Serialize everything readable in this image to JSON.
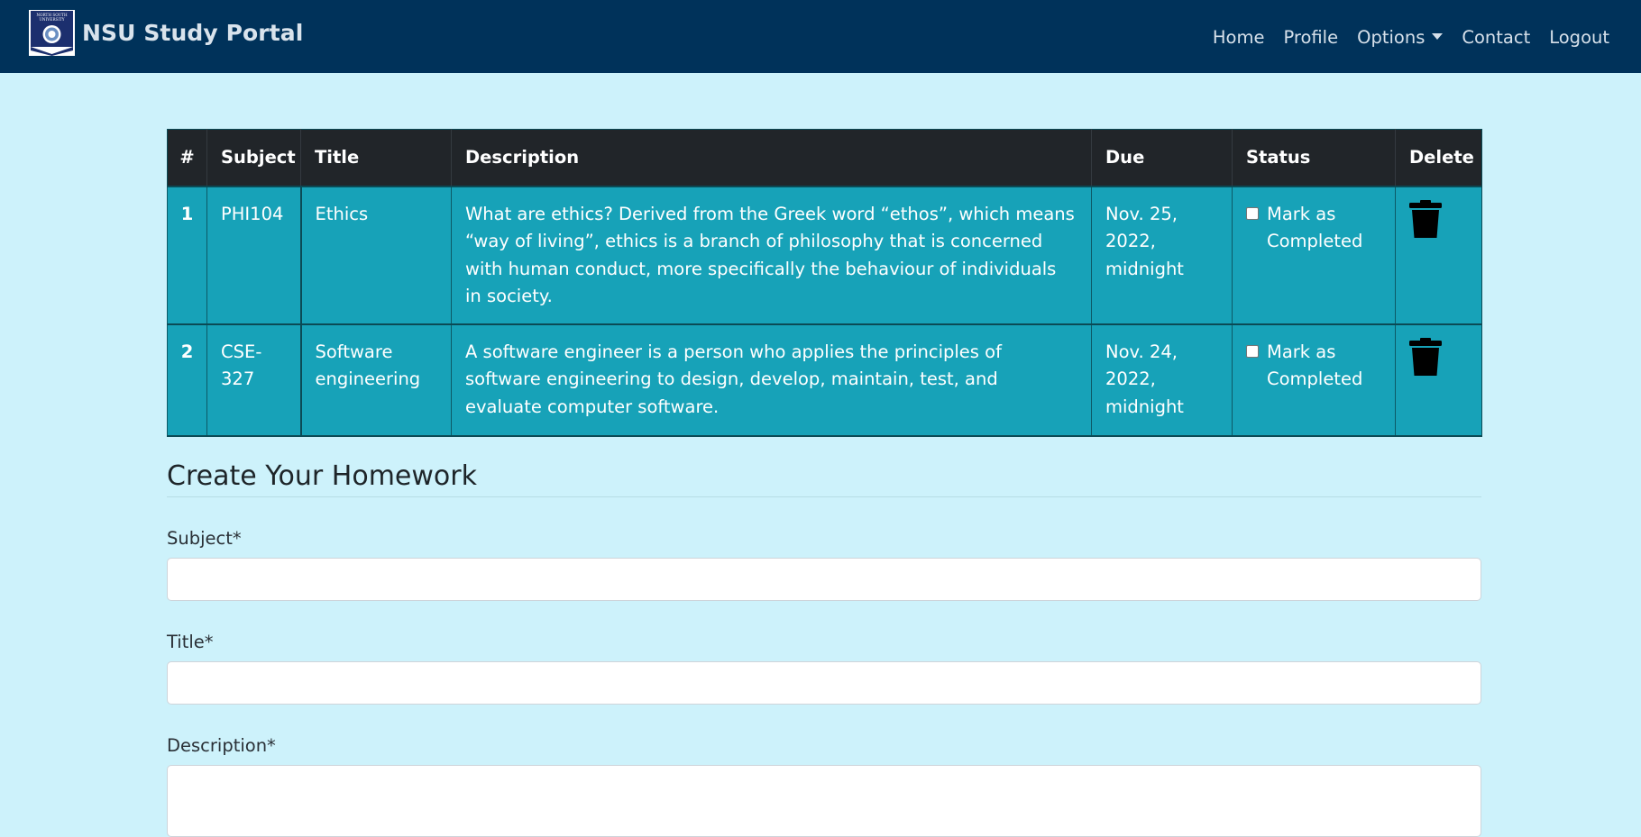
{
  "brand": {
    "name": "NSU Study Portal",
    "logo_lines": [
      "NORTH SOUTH",
      "UNIVERSITY"
    ]
  },
  "nav": {
    "items": [
      {
        "label": "Home"
      },
      {
        "label": "Profile"
      },
      {
        "label": "Options",
        "dropdown": true
      },
      {
        "label": "Contact"
      },
      {
        "label": "Logout"
      }
    ]
  },
  "table": {
    "headers": [
      "#",
      "Subject",
      "Title",
      "Description",
      "Due",
      "Status",
      "Delete"
    ],
    "rows": [
      {
        "num": "1",
        "subject": "PHI104",
        "title": "Ethics",
        "description": "What are ethics? Derived from the Greek word “ethos”, which means “way of living”, ethics is a branch of philosophy that is concerned with human conduct, more specifically the behaviour of individuals in society.",
        "due": "Nov. 25, 2022, midnight",
        "status_label": "Mark as Completed",
        "checked": false
      },
      {
        "num": "2",
        "subject": "CSE-327",
        "title": "Software engineering",
        "description": "A software engineer is a person who applies the principles of software engineering to design, develop, maintain, test, and evaluate computer software.",
        "due": "Nov. 24, 2022, midnight",
        "status_label": "Mark as Completed",
        "checked": false
      }
    ],
    "delete_icon": "trash-icon"
  },
  "form": {
    "heading": "Create Your Homework",
    "fields": [
      {
        "label": "Subject*",
        "value": ""
      },
      {
        "label": "Title*",
        "value": ""
      },
      {
        "label": "Description*",
        "value": ""
      }
    ]
  },
  "colors": {
    "navbar": "#00325a",
    "background": "#cdf2fb",
    "table_header": "#212529",
    "table_row": "#17a2b8"
  }
}
